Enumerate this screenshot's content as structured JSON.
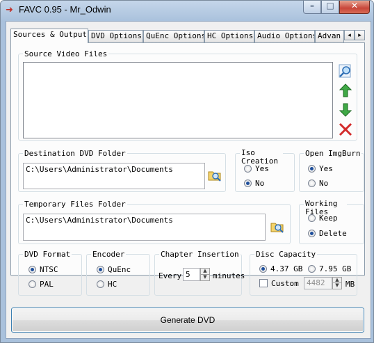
{
  "window": {
    "title": "FAVC 0.95 - Mr_Odwin",
    "icon": "red-arrow-icon",
    "controls": {
      "minimize": "–",
      "maximize": "□",
      "close": "✕"
    }
  },
  "tabs": [
    {
      "label": "Sources & Output",
      "active": true
    },
    {
      "label": "DVD Options",
      "active": false
    },
    {
      "label": "QuEnc Options",
      "active": false
    },
    {
      "label": "HC Options",
      "active": false
    },
    {
      "label": "Audio Options",
      "active": false
    },
    {
      "label": "Advan",
      "active": false
    }
  ],
  "tab_scroll": {
    "left": "◂",
    "right": "▸"
  },
  "source_video": {
    "legend": "Source Video Files",
    "icons": [
      "preview-icon",
      "move-up-icon",
      "move-down-icon",
      "remove-icon"
    ]
  },
  "destination": {
    "legend": "Destination DVD Folder",
    "value": "C:\\Users\\Administrator\\Documents"
  },
  "iso_creation": {
    "legend": "Iso Creation",
    "options": [
      {
        "label": "Yes",
        "selected": false
      },
      {
        "label": "No",
        "selected": true
      }
    ]
  },
  "open_imgburn": {
    "legend": "Open ImgBurn",
    "options": [
      {
        "label": "Yes",
        "selected": true
      },
      {
        "label": "No",
        "selected": false
      }
    ]
  },
  "temporary": {
    "legend": "Temporary Files Folder",
    "value": "C:\\Users\\Administrator\\Documents"
  },
  "working_files": {
    "legend": "Working Files",
    "options": [
      {
        "label": "Keep",
        "selected": false
      },
      {
        "label": "Delete",
        "selected": true
      }
    ]
  },
  "dvd_format": {
    "legend": "DVD Format",
    "options": [
      {
        "label": "NTSC",
        "selected": true
      },
      {
        "label": "PAL",
        "selected": false
      }
    ]
  },
  "encoder": {
    "legend": "Encoder",
    "options": [
      {
        "label": "QuEnc",
        "selected": true
      },
      {
        "label": "HC",
        "selected": false
      }
    ]
  },
  "chapter": {
    "legend": "Chapter Insertion",
    "prefix": "Every",
    "value": "5",
    "suffix": "minutes"
  },
  "disc": {
    "legend": "Disc Capacity",
    "options": [
      {
        "label": "4.37 GB",
        "selected": true
      },
      {
        "label": "7.95 GB",
        "selected": false
      }
    ],
    "custom_label": "Custom",
    "custom_checked": false,
    "custom_value": "4482",
    "custom_unit": "MB"
  },
  "generate_label": "Generate DVD",
  "colors": {
    "titlebar": "#a9c1dc",
    "close": "#c8463a",
    "button_border": "#3c7fb1"
  }
}
